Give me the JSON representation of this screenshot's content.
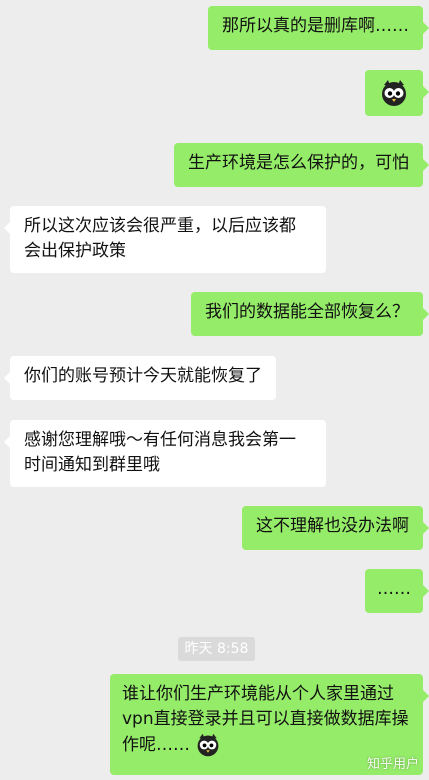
{
  "messages": [
    {
      "side": "me",
      "text": "那所以真的是删库啊……"
    },
    {
      "side": "me",
      "emoji": "owl-emoji"
    },
    {
      "side": "me",
      "text": "生产环境是怎么保护的，可怕"
    },
    {
      "side": "them",
      "text": "所以这次应该会很严重，以后应该都会出保护政策"
    },
    {
      "side": "me",
      "text": "我们的数据能全部恢复么？"
    },
    {
      "side": "them",
      "text": "你们的账号预计今天就能恢复了"
    },
    {
      "side": "them",
      "text": "感谢您理解哦～有任何消息我会第一时间通知到群里哦"
    },
    {
      "side": "me",
      "text": "这不理解也没办法啊"
    },
    {
      "side": "me",
      "text": "……"
    },
    {
      "side": "me",
      "text": "谁让你们生产环境能从个人家里通过vpn直接登录并且可以直接做数据库操作呢……"
    }
  ],
  "timestamp": "昨天 8:58",
  "watermark": "知乎用户"
}
